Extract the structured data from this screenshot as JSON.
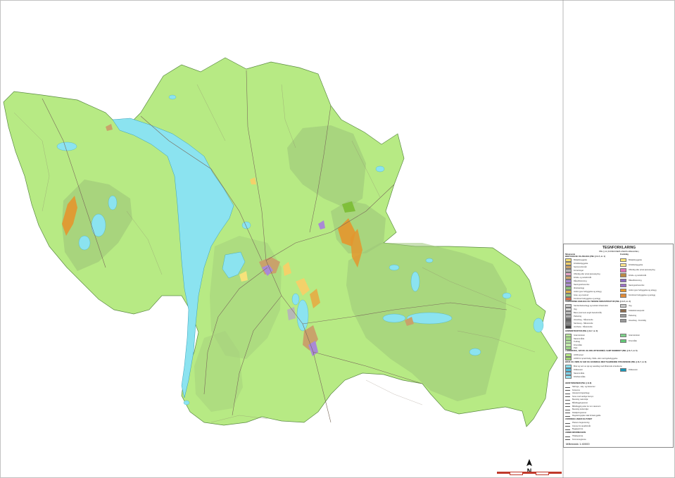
{
  "legend": {
    "title": "TEGNFORKLARING",
    "subtitle": "PBL § 11 (KOMMUNEPLANENS AREALDEL)",
    "col_left_header": "Nåværende",
    "col_right_header": "Fremtidig",
    "section_bygg": "BEBYGGELSE OG ANLEGG (PBL § 11-7, nr. 1)",
    "left_items_bygg": [
      {
        "label": "Boligbebyggelse",
        "color": "#f6e27a"
      },
      {
        "label": "Fritidsbebyggelse",
        "color": "#f3d16a"
      },
      {
        "label": "Sentrumsformål",
        "color": "#c9a26b"
      },
      {
        "label": "Forretninger",
        "color": "#b7b7b7"
      },
      {
        "label": "Offentlig eller privat tjenesteyting",
        "color": "#e7a5c6"
      },
      {
        "label": "Fritids- og turistformål",
        "color": "#d0a86e"
      },
      {
        "label": "Råstoffutvinning",
        "color": "#a98ad6"
      },
      {
        "label": "Næringsvirksomhet",
        "color": "#b393d3"
      },
      {
        "label": "Idrettsanlegg",
        "color": "#8fc77a"
      },
      {
        "label": "Andre typer bebyggelse og anlegg",
        "color": "#e1b24a"
      },
      {
        "label": "Grav- og urnelund",
        "color": "#9ccc8a"
      },
      {
        "label": "Kombinert bebyggelse og anlegg",
        "color": "#d96f4a"
      }
    ],
    "right_items_bygg": [
      {
        "label": "Boligbebyggelse",
        "color": "#ffe678"
      },
      {
        "label": "Fritidsbebyggelse",
        "color": "#fde58c"
      },
      {
        "label": "Offentlig eller privat tjenesteyting",
        "color": "#de76b3"
      },
      {
        "label": "Fritids- og turistformål",
        "color": "#bb8a45"
      },
      {
        "label": "Råstoffutvinning",
        "color": "#8c6ac0"
      },
      {
        "label": "Næringsvirksomhet",
        "color": "#9c71c6"
      },
      {
        "label": "Andre typer bebyggelse og anlegg",
        "color": "#e4962e"
      },
      {
        "label": "Kombinert bebyggelse og anlegg",
        "color": "#e08c3c"
      }
    ],
    "section_samferdsel": "SAMFERDSELSANLEGG OG TEKNISK INFRASTRUKTUR (PBL § 11-7, nr. 2)",
    "left_items_samf": [
      {
        "label": "Samferdselsanlegg og teknisk infrastruktur",
        "color": "#cccccc"
      },
      {
        "label": "Veg",
        "color": "#d9d9d9"
      },
      {
        "label": "Bane (nærmere angitt baneformål)",
        "color": "#bdbdbd"
      },
      {
        "label": "Parkering",
        "color": "#b0b0b0"
      },
      {
        "label": "Hovedveg - Nåværende",
        "color": "#666666"
      },
      {
        "label": "Samleveg - Nåværende",
        "color": "#888888"
      },
      {
        "label": "Jernbane - Nåværende",
        "color": "#444444"
      }
    ],
    "right_items_samf": [
      {
        "label": "Veg",
        "color": "#c8c8c8"
      },
      {
        "label": "Kollektivknutepunkt",
        "color": "#8a6b4e"
      },
      {
        "label": "Parkering",
        "color": "#9a9a9a"
      },
      {
        "label": "Hovedveg - Fremtidig",
        "color": "#999999"
      }
    ],
    "section_gronn": "GRØNNSTRUKTUR (PBL § 11-7, nr. 3)",
    "left_items_gronn": [
      {
        "label": "Grønnstruktur",
        "color": "#b9e39b"
      },
      {
        "label": "Naturområde",
        "color": "#a8da8d"
      },
      {
        "label": "Turdrag",
        "color": "#b4e2a4"
      },
      {
        "label": "Friområde",
        "color": "#c6ebaf"
      },
      {
        "label": "Park",
        "color": "#9fd98a"
      }
    ],
    "right_items_gronn": [
      {
        "label": "Grønnstruktur",
        "color": "#7ed28a"
      },
      {
        "label": "Friområde",
        "color": "#63c977"
      }
    ],
    "section_lnfr": "LANDBRUKS-, NATUR- OG FRILUFTSFORMÅL SAMT REINDRIFT (PBL § 11-7, nr. 5)",
    "left_items_lnfr": [
      {
        "label": "LNFR-areal",
        "color": "#b7ea84"
      },
      {
        "label": "LNFR for spredt bolig- fritids- eller næringsbebyggelse",
        "color": "#a5d879"
      }
    ],
    "section_vann": "BRUK OG VERN AV SJØ OG VASSDRAG MED TILHØRENDE STRANDSONE (PBL § 11-7, nr. 6)",
    "left_items_vann": [
      {
        "label": "Bruk og vern av sjø og vassdrag med tilhørende strandsone",
        "color": "#8be3f0"
      },
      {
        "label": "Drikkevann",
        "color": "#55c1e5"
      },
      {
        "label": "Naturområde",
        "color": "#7fd4ea"
      },
      {
        "label": "Friluftsområde",
        "color": "#9ae6f4"
      }
    ],
    "right_items_vann": [
      {
        "label": "Drikkevann",
        "color": "#1a98b8"
      }
    ],
    "section_hensyn": "HENSYNSSONER (PBL § 11-8)",
    "hensyn_items": [
      "Sikrings-, støy- og faresoner",
      "Faresone",
      "Høyspenningsanlegg",
      "Sone med særlige hensyn",
      "Bevaring naturmiljø",
      "Båndleggingssoner",
      "Båndlegging etter lov om naturvern",
      "Bevaring kulturmiljø",
      "Detaljeringssoner",
      "Reguleringsplan skal fortsatt gjelde"
    ],
    "section_juridisk": "JURIDISKE LINJER OG PUNKT",
    "juridisk_items": [
      "Planens begrensning",
      "Grense for arealformål",
      "Byggegrense"
    ],
    "section_annen": "ANNEN INFORMASJON",
    "annen_items": [
      "Tiltaksgrense",
      "Kommunegrense"
    ],
    "scale_text": "Målestokk 1:40000"
  },
  "north_arrow": {
    "letter": "N"
  },
  "colors": {
    "lnfr": "#b7ea84",
    "lnfr_dark": "#a7d27d",
    "lnfr_zone": "#9fc77a",
    "water": "#8be3f0",
    "water_dark": "#55c8e8",
    "settlement": "#f3d16a",
    "industry": "#a98ad6",
    "orange": "#e4962e",
    "road": "#7a6a5a"
  }
}
